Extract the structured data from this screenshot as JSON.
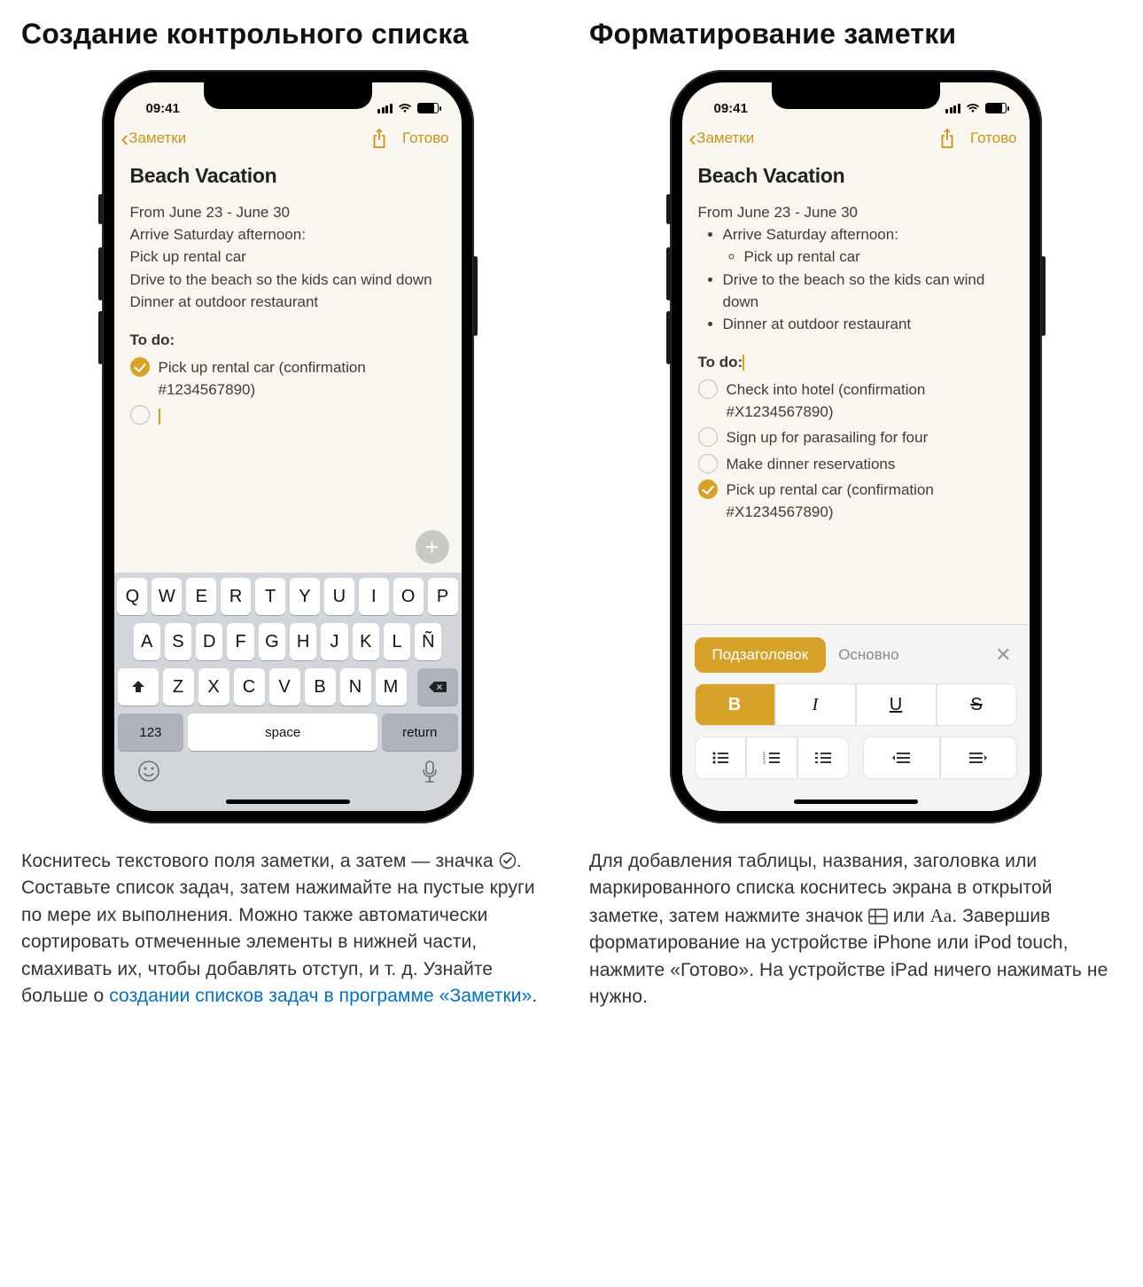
{
  "left": {
    "heading": "Создание контрольного списка",
    "phone": {
      "time": "09:41",
      "back": "Заметки",
      "done": "Готово",
      "title": "Beach Vacation",
      "lines": [
        "From June 23 - June 30",
        "Arrive Saturday afternoon:",
        "Pick up rental car",
        "Drive to the beach so the kids can wind down",
        "Dinner at outdoor restaurant"
      ],
      "todo_heading": "To do:",
      "todos": [
        {
          "text": "Pick up rental car (confirmation #1234567890)",
          "done": true
        },
        {
          "text": "",
          "done": false
        }
      ],
      "keyboard": {
        "row1": [
          "Q",
          "W",
          "E",
          "R",
          "T",
          "Y",
          "U",
          "I",
          "O",
          "P"
        ],
        "row2": [
          "A",
          "S",
          "D",
          "F",
          "G",
          "H",
          "J",
          "K",
          "L",
          "Ñ"
        ],
        "row3": [
          "Z",
          "X",
          "C",
          "V",
          "B",
          "N",
          "M"
        ],
        "k123": "123",
        "space": "space",
        "ret": "return"
      }
    },
    "caption_parts": {
      "p1": "Коснитесь текстового поля заметки, а затем — значка ",
      "p2": ". Составьте список задач, затем нажимайте на пустые круги по мере их выполнения. Можно также автоматически сортировать отмеченные элементы в нижней части, смахивать их, чтобы добавлять отступ, и т. д. Узнайте больше о ",
      "link": "создании списков задач в программе «Заметки»",
      "p3": "."
    }
  },
  "right": {
    "heading": "Форматирование заметки",
    "phone": {
      "time": "09:41",
      "back": "Заметки",
      "done": "Готово",
      "title": "Beach Vacation",
      "first_line": "From June 23 - June 30",
      "bullets": [
        {
          "text": "Arrive Saturday afternoon:",
          "sub": [
            "Pick up rental car"
          ]
        },
        {
          "text": "Drive to the beach so the kids can wind down"
        },
        {
          "text": "Dinner at outdoor restaurant"
        }
      ],
      "todo_heading": "To do:",
      "todos": [
        {
          "text": "Check into hotel (confirmation #X1234567890)",
          "done": false
        },
        {
          "text": "Sign up for parasailing for four",
          "done": false
        },
        {
          "text": "Make dinner reservations",
          "done": false
        },
        {
          "text": "Pick up rental car (confirmation #X1234567890)",
          "done": true
        }
      ],
      "format": {
        "chip": "Подзаголовок",
        "plain": "Основно",
        "biu": [
          "B",
          "I",
          "U",
          "S"
        ]
      }
    },
    "caption_parts": {
      "p1": "Для добавления таблицы, названия, заголовка или маркированного списка коснитесь экрана в открытой заметке, затем нажмите значок ",
      "p2": " или ",
      "aa": "Aa",
      "p3": ". Завершив форматирование на устройстве iPhone или iPod touch, нажмите «Готово». На устройстве iPad ничего нажимать не нужно."
    }
  }
}
